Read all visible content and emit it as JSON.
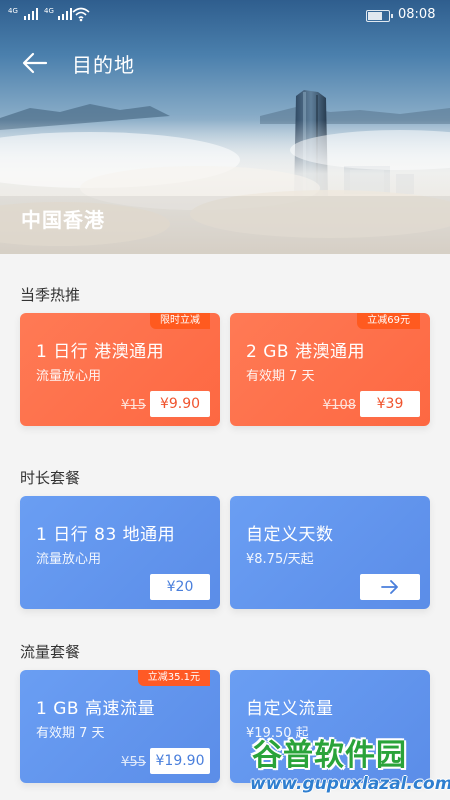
{
  "status_bar": {
    "signal1": "4G",
    "signal2": "4G",
    "time": "08:08"
  },
  "header": {
    "title": "目的地",
    "destination": "中国香港"
  },
  "sections": [
    {
      "title": "当季热推",
      "cards": [
        {
          "name": "1 日行  港澳通用",
          "desc": "流量放心用",
          "tag": "限时立减",
          "old_price": "¥15",
          "price": "¥9.90"
        },
        {
          "name": "2 GB 港澳通用",
          "desc": "有效期 7 天",
          "tag": "立减69元",
          "old_price": "¥108",
          "price": "¥39"
        }
      ]
    },
    {
      "title": "时长套餐",
      "cards": [
        {
          "name": "1 日行  83 地通用",
          "desc": "流量放心用",
          "price": "¥20"
        },
        {
          "name": "自定义天数",
          "desc": "¥8.75/天起",
          "action_icon": "arrow-right-icon"
        }
      ]
    },
    {
      "title": "流量套餐",
      "cards": [
        {
          "name": "1 GB 高速流量",
          "desc": "有效期 7 天",
          "tag": "立减35.1元",
          "old_price": "¥55",
          "price": "¥19.90"
        },
        {
          "name": "自定义流量",
          "desc": "¥19.50 起"
        }
      ]
    }
  ],
  "watermark": {
    "brand": "谷普软件园",
    "url": "www.gupuxlazal.com"
  },
  "colors": {
    "hot_card": "#fd6842",
    "plan_card": "#5b8de8",
    "tag": "#ff5a1f",
    "watermark_green": "#2aa33a",
    "watermark_blue": "#2f7fd0"
  }
}
